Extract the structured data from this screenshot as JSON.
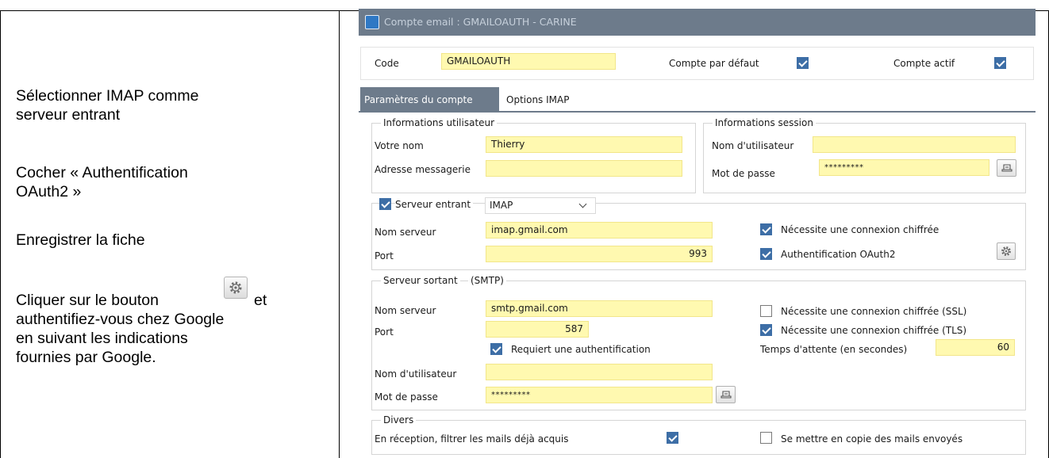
{
  "instructions": {
    "line1": "Sélectionner IMAP comme",
    "line2": "serveur entrant",
    "line3": "Cocher « Authentification",
    "line4": "OAuth2 »",
    "line5": "Enregistrer la fiche",
    "line6a": "Cliquer sur le bouton",
    "line6b": "et",
    "line7": "authentifiez-vous chez Google",
    "line8": "en suivant les indications",
    "line9": "fournies par Google.",
    "inline_icon": "gear-icon"
  },
  "window": {
    "title": "Compte email : GMAILOAUTH - CARINE",
    "icon": "app-icon"
  },
  "header": {
    "code_label": "Code",
    "code_value": "GMAILOAUTH",
    "default_label": "Compte par défaut",
    "default_checked": true,
    "active_label": "Compte actif",
    "active_checked": true
  },
  "tabs": [
    {
      "label": "Paramètres du compte",
      "active": true
    },
    {
      "label": "Options IMAP",
      "active": false
    }
  ],
  "user_info": {
    "legend": "Informations utilisateur",
    "name_label": "Votre nom",
    "name_value": "Thierry",
    "email_label": "Adresse messagerie",
    "email_value": ""
  },
  "session_info": {
    "legend": "Informations session",
    "user_label": "Nom d'utilisateur",
    "user_value": "",
    "pwd_label": "Mot de passe",
    "pwd_value": "*********",
    "pwd_button_icon": "keyboard-icon"
  },
  "incoming": {
    "checkbox_label": "Serveur entrant",
    "checked": true,
    "protocol": "IMAP",
    "server_label": "Nom serveur",
    "server_value": "imap.gmail.com",
    "port_label": "Port",
    "port_value": "993",
    "encrypted_label": "Nécessite une connexion chiffrée",
    "encrypted_checked": true,
    "oauth_label": "Authentification OAuth2",
    "oauth_checked": true,
    "oauth_button_icon": "gear-icon"
  },
  "outgoing": {
    "legend": "Serveur sortant",
    "legend_suffix": "(SMTP)",
    "server_label": "Nom serveur",
    "server_value": "smtp.gmail.com",
    "port_label": "Port",
    "port_value": "587",
    "ssl_label": "Nécessite une connexion chiffrée (SSL)",
    "ssl_checked": false,
    "tls_label": "Nécessite une connexion chiffrée (TLS)",
    "tls_checked": true,
    "auth_label": "Requiert une authentification",
    "auth_checked": true,
    "timeout_label": "Temps d'attente (en secondes)",
    "timeout_value": "60",
    "user_label": "Nom d'utilisateur",
    "user_value": "",
    "pwd_label": "Mot de passe",
    "pwd_value": "*********",
    "pwd_button_icon": "keyboard-icon"
  },
  "misc": {
    "legend": "Divers",
    "filter_label": "En réception, filtrer les mails déjà acquis",
    "filter_checked": true,
    "copy_label": "Se mettre en copie des mails envoyés",
    "copy_checked": false
  },
  "colors": {
    "field_bg": "#fff9b0",
    "titlebar": "#6d7b8b",
    "checkbox_on": "#3d6ea6"
  }
}
